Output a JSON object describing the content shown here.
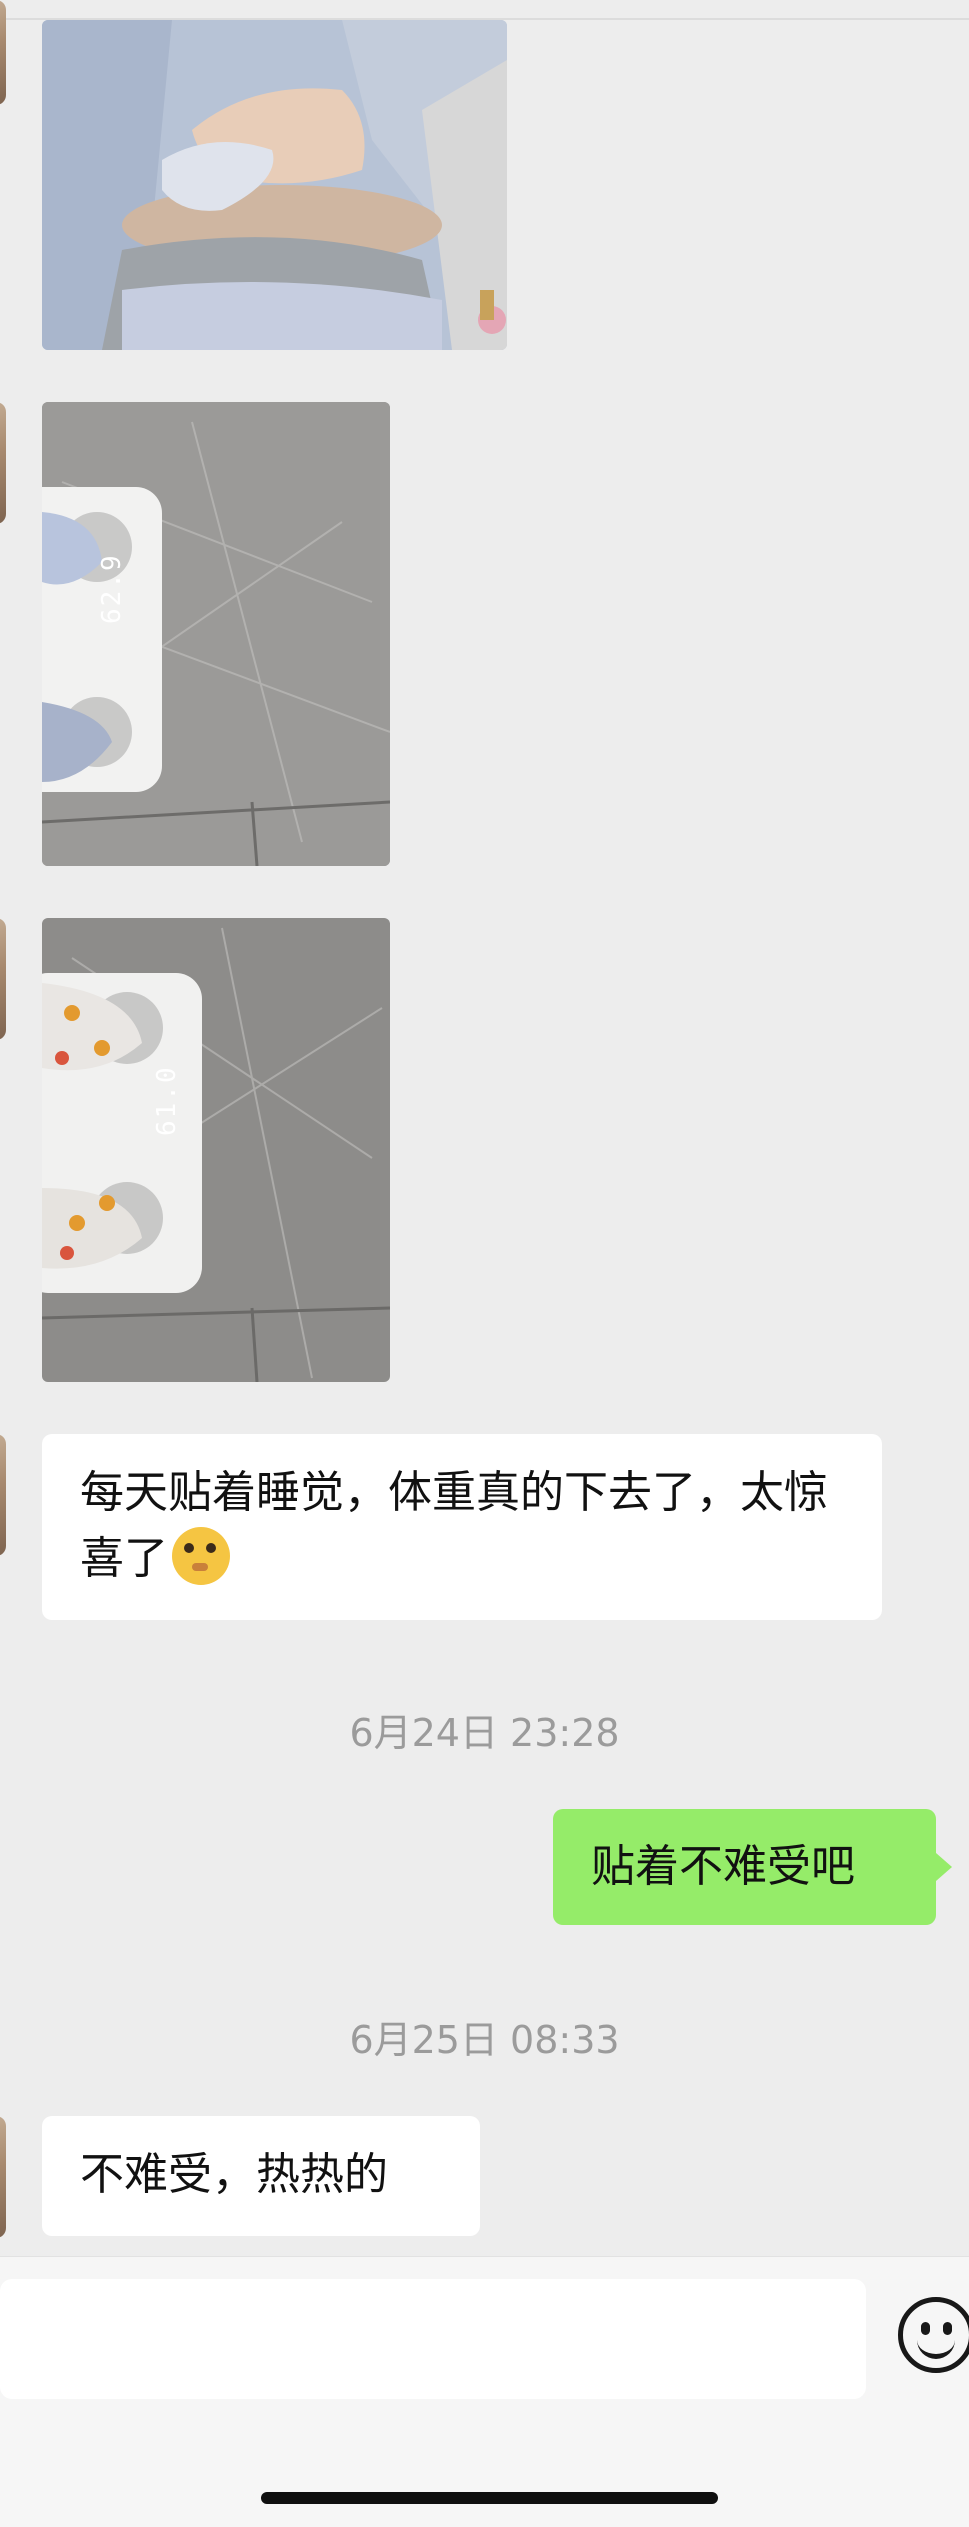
{
  "messages": {
    "msg1_text": "每天贴着睡觉，体重真的下去了，太惊喜了",
    "msg1_emoji": "yellow-face-emoji",
    "time1": "6月24日 23:28",
    "msg2_text": "贴着不难受吧",
    "time2": "6月25日 08:33",
    "msg3_text": "不难受，热热的"
  },
  "photos": {
    "scale1_reading": "62.9",
    "scale2_reading": "61.0"
  },
  "colors": {
    "chat_bg": "#ededed",
    "bubble_self": "#95ec69",
    "bubble_other": "#ffffff",
    "timestamp": "#9b9b9b"
  },
  "icons": [
    "emoji-smiley-icon"
  ]
}
